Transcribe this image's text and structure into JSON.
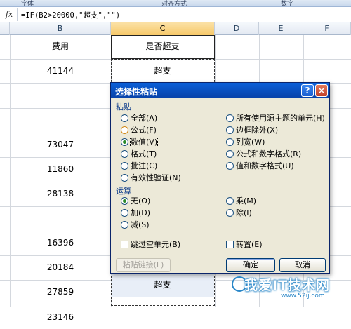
{
  "ribbon": {
    "labels": [
      "字体",
      "对齐方式",
      "数字"
    ]
  },
  "formula_bar": {
    "fx": "fx",
    "formula": "=IF(B2>20000,\"超支\",\"\")"
  },
  "columns": [
    "B",
    "C",
    "D",
    "E",
    "F"
  ],
  "cells": {
    "b_header": "费用",
    "c_header": "是否超支",
    "b_values": [
      "41144",
      "",
      "73047",
      "11860",
      "28138",
      "",
      "16396",
      "20184",
      "27859",
      "23146"
    ],
    "c_values": [
      "超支",
      "",
      "",
      "",
      "",
      "",
      "",
      "",
      "",
      "超支"
    ]
  },
  "dialog": {
    "title": "选择性粘贴",
    "help": "?",
    "close": "×",
    "paste_section": "粘贴",
    "paste_left": [
      "全部(A)",
      "公式(F)",
      "数值(V)",
      "格式(T)",
      "批注(C)",
      "有效性验证(N)"
    ],
    "paste_right": [
      "所有使用源主题的单元(H)",
      "边框除外(X)",
      "列宽(W)",
      "公式和数字格式(R)",
      "值和数字格式(U)"
    ],
    "op_section": "运算",
    "op_left": [
      "无(O)",
      "加(D)",
      "减(S)"
    ],
    "op_right": [
      "乘(M)",
      "除(I)"
    ],
    "skip_blanks": "跳过空单元(B)",
    "transpose": "转置(E)",
    "paste_link": "粘贴链接(L)",
    "ok": "确定",
    "cancel": "取消"
  },
  "watermark": {
    "text": "我爱IT技术网",
    "url": "www.52ij.com"
  }
}
